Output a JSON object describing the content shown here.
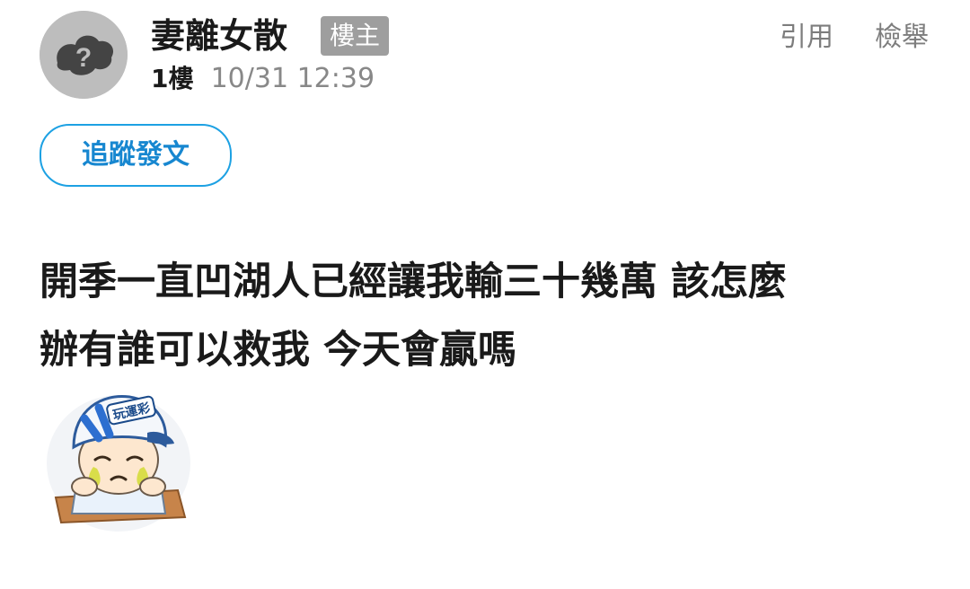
{
  "post": {
    "author": "妻離女散",
    "op_badge": "樓主",
    "floor": "1樓",
    "timestamp": "10/31 12:39",
    "follow_label": "追蹤發文",
    "content_lines": [
      "開季一直凹湖人已經讓我輸三十幾萬 該怎麼",
      "辦有誰可以救我 今天會贏嗎"
    ]
  },
  "actions": {
    "quote_label": "引用",
    "report_label": "檢舉"
  },
  "avatar": {
    "icon": "default-user-avatar-icon",
    "glyph": "?"
  },
  "sticker": {
    "icon": "crying-baseball-boy-sticker",
    "cap_text": "玩運彩"
  },
  "colors": {
    "accent": "#1da1e3",
    "badge_bg": "#9e9e9e",
    "muted_text": "#888888"
  }
}
